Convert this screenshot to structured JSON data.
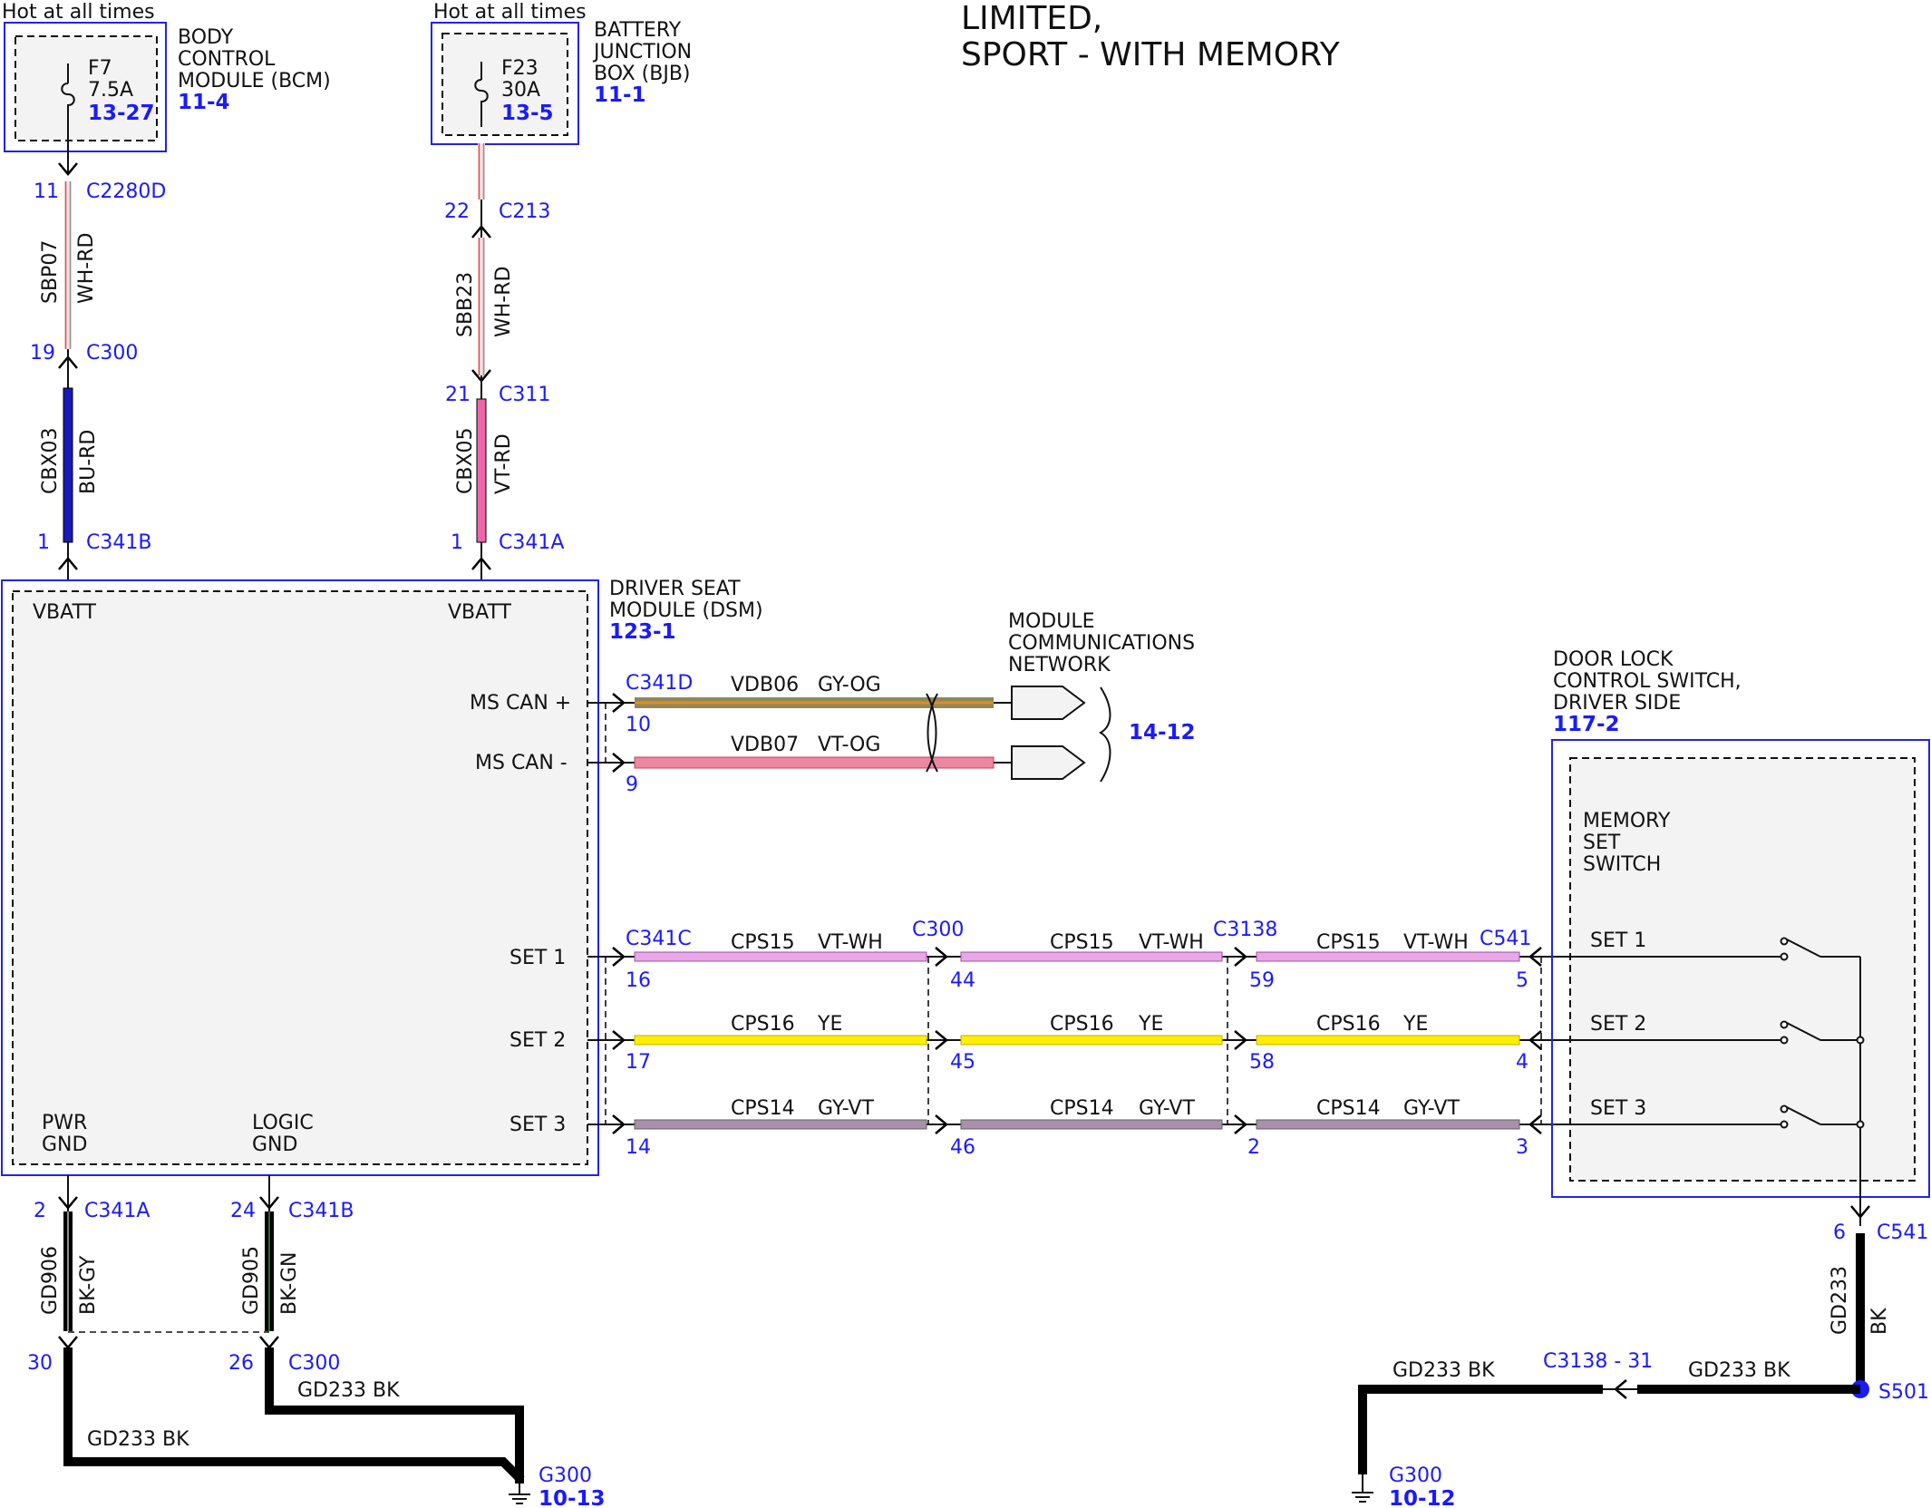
{
  "title": {
    "line1": "LIMITED,",
    "line2": "SPORT - WITH MEMORY"
  },
  "colors": {
    "link_blue": "#1a1aff",
    "box_blue": "#2222ee",
    "bu_rd": "#1a1ab8",
    "vt_rd": "#ee66aa",
    "gy_og": "#8a8a5a",
    "vt_og": "#ee88a0",
    "vt_wh": "#e8a8e8",
    "ye": "#ffee00",
    "gy_vt": "#a890a8",
    "bk": "#000000"
  },
  "bcm": {
    "hot": "Hot at all times",
    "name": [
      "BODY",
      "CONTROL",
      "MODULE (BCM)"
    ],
    "ref": "11-4",
    "fuse": "F7",
    "amps": "7.5A",
    "fuse_ref": "13-27"
  },
  "bjb": {
    "hot": "Hot at all times",
    "name": [
      "BATTERY",
      "JUNCTION",
      "BOX (BJB)"
    ],
    "ref": "11-1",
    "fuse": "F23",
    "amps": "30A",
    "fuse_ref": "13-5"
  },
  "feed_left": {
    "pin_top": "11",
    "conn_top": "C2280D",
    "circuit1": "SBP07",
    "color1": "WH-RD",
    "pin_mid": "19",
    "conn_mid": "C300",
    "circuit2": "CBX03",
    "color2": "BU-RD",
    "pin_bot": "1",
    "conn_bot": "C341B"
  },
  "feed_right": {
    "pin_top": "22",
    "conn_top": "C213",
    "circuit1": "SBB23",
    "color1": "WH-RD",
    "pin_mid": "21",
    "conn_mid": "C311",
    "circuit2": "CBX05",
    "color2": "VT-RD",
    "pin_bot": "1",
    "conn_bot": "C341A"
  },
  "dsm": {
    "name": [
      "DRIVER SEAT",
      "MODULE (DSM)"
    ],
    "ref": "123-1",
    "vbatt": "VBATT",
    "ms_can_plus": "MS CAN +",
    "ms_can_minus": "MS CAN -",
    "set1": "SET 1",
    "set2": "SET 2",
    "set3": "SET 3",
    "pwr_gnd": [
      "PWR",
      "GND"
    ],
    "logic_gnd": [
      "LOGIC",
      "GND"
    ]
  },
  "network": {
    "name": [
      "MODULE",
      "COMMUNICATIONS",
      "NETWORK"
    ],
    "ref": "14-12",
    "conn": "C341D",
    "can_plus": {
      "pin": "10",
      "circuit": "VDB06",
      "color": "GY-OG"
    },
    "can_minus": {
      "pin": "9",
      "circuit": "VDB07",
      "color": "VT-OG"
    }
  },
  "set_wires": {
    "conn_dsm": "C341C",
    "conn_mid1": "C300",
    "conn_mid2": "C3138",
    "conn_sw": "C541",
    "rows": [
      {
        "circuit": "CPS15",
        "color": "VT-WH",
        "pins": [
          "16",
          "44",
          "59",
          "5"
        ]
      },
      {
        "circuit": "CPS16",
        "color": "YE",
        "pins": [
          "17",
          "45",
          "58",
          "4"
        ]
      },
      {
        "circuit": "CPS14",
        "color": "GY-VT",
        "pins": [
          "14",
          "46",
          "2",
          "3"
        ]
      }
    ]
  },
  "door_switch": {
    "name": [
      "DOOR LOCK",
      "CONTROL SWITCH,",
      "DRIVER SIDE"
    ],
    "ref": "117-2",
    "inner": [
      "MEMORY",
      "SET",
      "SWITCH"
    ],
    "set1": "SET 1",
    "set2": "SET 2",
    "set3": "SET 3"
  },
  "ground_left": {
    "pwr": {
      "pin_top": "2",
      "conn_top": "C341A",
      "circuit": "GD906",
      "color": "BK-GY",
      "pin_bot": "30"
    },
    "logic": {
      "pin_top": "24",
      "conn_top": "C341B",
      "circuit": "GD905",
      "color": "BK-GN",
      "pin_bot": "26",
      "conn_bot": "C300"
    },
    "wire1": "GD233  BK",
    "wire2": "GD233  BK",
    "ground": "G300",
    "ref": "10-13"
  },
  "ground_right": {
    "pin": "6",
    "conn": "C541",
    "circuit": "GD233",
    "color": "BK",
    "splice": "S501",
    "inline_conn": "C3138 - 31",
    "wire1": "GD233  BK",
    "wire2": "GD233  BK",
    "ground": "G300",
    "ref": "10-12"
  }
}
